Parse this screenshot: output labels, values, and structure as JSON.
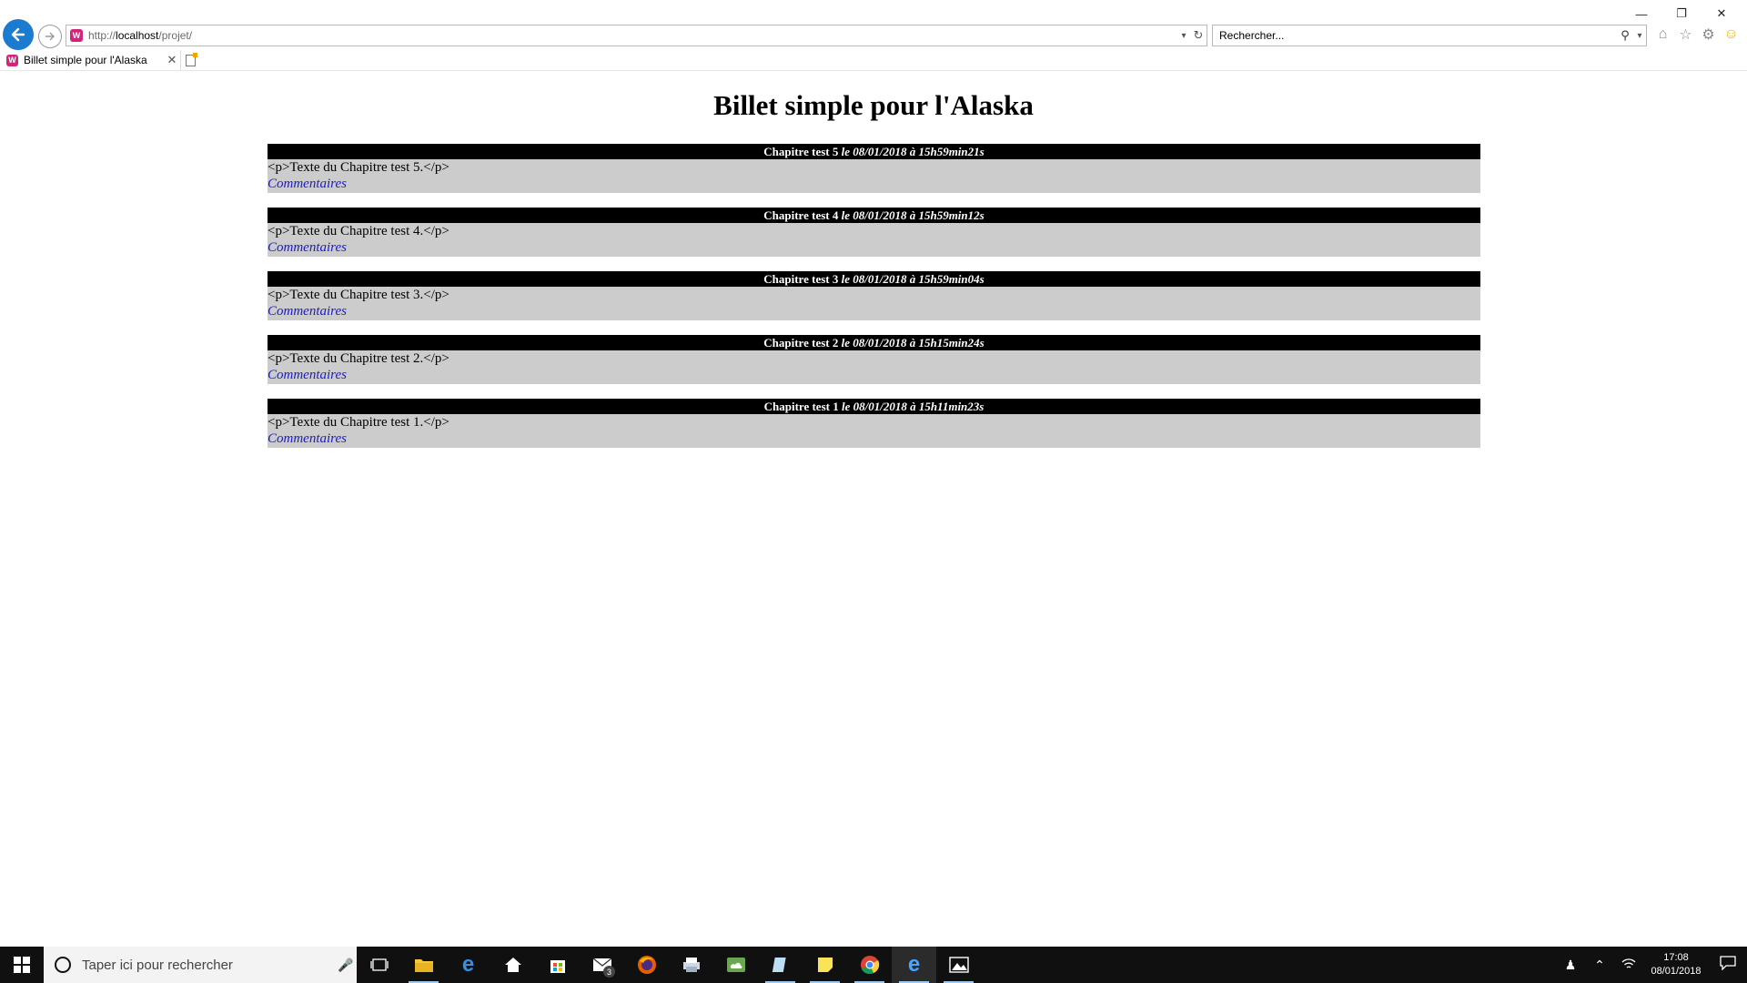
{
  "browser": {
    "url_scheme": "http://",
    "url_host": "localhost",
    "url_path": "/projet/",
    "search_placeholder": "Rechercher...",
    "tab_title": "Billet simple pour l'Alaska"
  },
  "page": {
    "title": "Billet simple pour l'Alaska",
    "posts": [
      {
        "title": "Chapitre test 5",
        "date": "le 08/01/2018 à 15h59min21s",
        "text": "<p>Texte du Chapitre test 5.</p>",
        "link": "Commentaires"
      },
      {
        "title": "Chapitre test 4",
        "date": "le 08/01/2018 à 15h59min12s",
        "text": "<p>Texte du Chapitre test 4.</p>",
        "link": "Commentaires"
      },
      {
        "title": "Chapitre test 3",
        "date": "le 08/01/2018 à 15h59min04s",
        "text": "<p>Texte du Chapitre test 3.</p>",
        "link": "Commentaires"
      },
      {
        "title": "Chapitre test 2",
        "date": "le 08/01/2018 à 15h15min24s",
        "text": "<p>Texte du Chapitre test 2.</p>",
        "link": "Commentaires"
      },
      {
        "title": "Chapitre test 1",
        "date": "le 08/01/2018 à 15h11min23s",
        "text": "<p>Texte du Chapitre test 1.</p>",
        "link": "Commentaires"
      }
    ]
  },
  "taskbar": {
    "search_placeholder": "Taper ici pour rechercher",
    "mail_badge": "3",
    "time": "17:08",
    "date": "08/01/2018"
  },
  "colors": {
    "ie_blue": "#1a7bd0",
    "site_icon": "#d4237a",
    "post_header_bg": "#000000",
    "post_body_bg": "#cccccc",
    "link": "#1a1acc",
    "taskbar_bg": "#101010"
  }
}
